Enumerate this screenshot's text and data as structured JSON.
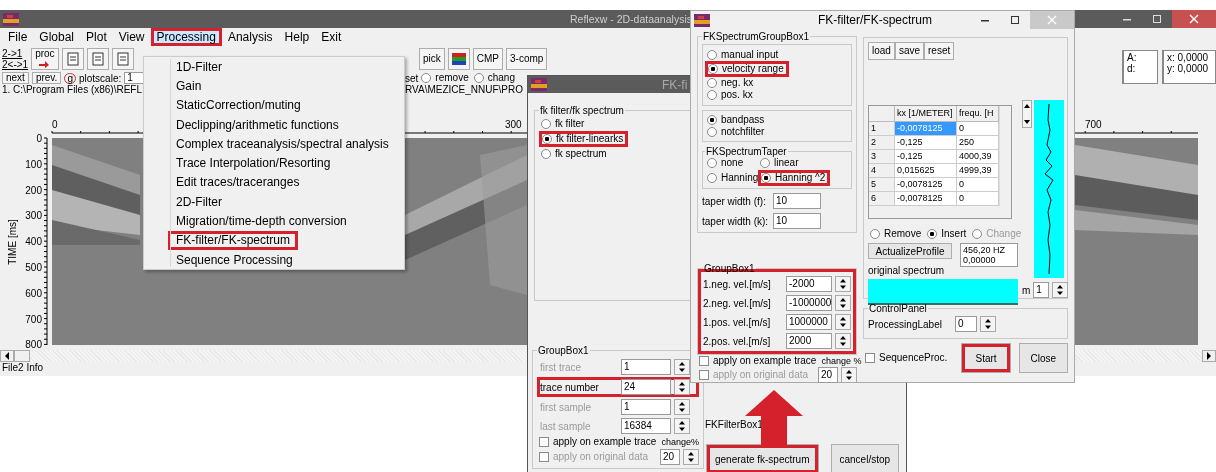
{
  "main_window": {
    "title": "Reflexw - 2D-dataanalysis",
    "menu": [
      {
        "label": "File",
        "selected": false,
        "highlighted": false
      },
      {
        "label": "Global",
        "selected": false,
        "highlighted": false
      },
      {
        "label": "Plot",
        "selected": false,
        "highlighted": false
      },
      {
        "label": "View",
        "selected": false,
        "highlighted": false
      },
      {
        "label": "Processing",
        "selected": true,
        "highlighted": true
      },
      {
        "label": "Analysis",
        "selected": false,
        "highlighted": false
      },
      {
        "label": "Help",
        "selected": false,
        "highlighted": false
      },
      {
        "label": "Exit",
        "selected": false,
        "highlighted": false
      }
    ],
    "menu_items": [
      {
        "label": "1D-Filter",
        "highlighted": false
      },
      {
        "label": "Gain",
        "highlighted": false
      },
      {
        "label": "StaticCorrection/muting",
        "highlighted": false
      },
      {
        "label": "Declipping/arithmetic functions",
        "highlighted": false
      },
      {
        "label": "Complex traceanalysis/spectral analysis",
        "highlighted": false
      },
      {
        "label": "Trace Interpolation/Resorting",
        "highlighted": false
      },
      {
        "label": "Edit traces/traceranges",
        "highlighted": false
      },
      {
        "label": "2D-Filter",
        "highlighted": false
      },
      {
        "label": "Migration/time-depth conversion",
        "highlighted": false
      },
      {
        "label": "FK-filter/FK-spectrum",
        "highlighted": true
      },
      {
        "label": "Sequence Processing",
        "highlighted": false
      }
    ],
    "toolbar": {
      "swap": [
        "2->1",
        "2<->1"
      ],
      "proc": "proc",
      "pick": "pick",
      "cmp": "CMP",
      "comp": "3-comp"
    },
    "nav": {
      "next": "next",
      "prev": "prev.",
      "g": "g",
      "plotscale_label": "plotscale:",
      "plotscale": "1",
      "set": "set",
      "options": [
        {
          "label": "remove",
          "selected": false
        },
        {
          "label": "chang",
          "selected": false
        }
      ]
    },
    "path": [
      "1. C:\\Program Files (x86)\\REFL",
      "RVA\\MEZICE_NNUF\\PRO"
    ],
    "x_ticks": [
      "0",
      "300",
      "700"
    ],
    "y_ticks": [
      "0",
      "100",
      "200",
      "300",
      "400",
      "500",
      "600",
      "700",
      "800"
    ],
    "y_label": "TIME [ms]",
    "info": {
      "a": "A:",
      "d": "d:",
      "x": "x: 0,0000",
      "y": "y: 0,0000"
    },
    "status": "File2 Info"
  },
  "dialog1": {
    "title": "FK-fi",
    "mode_group": "fk filter/fk spectrum",
    "modes": [
      {
        "label": "fk filter",
        "selected": false,
        "highlighted": false
      },
      {
        "label": "fk filter-linearks",
        "selected": true,
        "highlighted": true
      },
      {
        "label": "fk spectrum",
        "selected": false,
        "highlighted": false
      }
    ],
    "range_group": "GroupBox1",
    "ranges": [
      {
        "label": "first trace",
        "value": "1",
        "disabled": true,
        "highlighted": false
      },
      {
        "label": "trace number",
        "value": "24",
        "disabled": false,
        "highlighted": true
      },
      {
        "label": "first sample",
        "value": "1",
        "disabled": true,
        "highlighted": false
      },
      {
        "label": "last sample",
        "value": "16384",
        "disabled": true,
        "highlighted": false
      }
    ],
    "options": [
      {
        "label": "apply on example trace",
        "checked": false,
        "disabled": false
      },
      {
        "label": "apply on original data",
        "checked": false,
        "disabled": true
      }
    ],
    "change_label": "change%",
    "change": "20",
    "filter_group": "FKFilterBox1",
    "buttons": [
      {
        "label": "generate fk-spectrum",
        "highlighted": true
      },
      {
        "label": "cancel/stop",
        "highlighted": false
      }
    ]
  },
  "dialog2": {
    "title": "FK-filter/FK-spectrum",
    "spectrum_group": "FKSpectrumGroupBox1",
    "input_modes": [
      {
        "label": "manual input",
        "selected": false,
        "highlighted": false
      },
      {
        "label": "velocity range",
        "selected": true,
        "highlighted": true
      },
      {
        "label": "neg. kx",
        "selected": false,
        "highlighted": false
      },
      {
        "label": "pos. kx",
        "selected": false,
        "highlighted": false
      }
    ],
    "filter_types": [
      {
        "label": "bandpass",
        "selected": true
      },
      {
        "label": "notchfilter",
        "selected": false
      }
    ],
    "taper_group": "FKSpectrumTaper",
    "tapers": [
      {
        "label": "none",
        "selected": false,
        "highlighted": false
      },
      {
        "label": "Hanning",
        "selected": false,
        "highlighted": false
      },
      {
        "label": "linear",
        "selected": false,
        "highlighted": false
      },
      {
        "label": "Hanning ^2",
        "selected": true,
        "highlighted": true
      }
    ],
    "taper_widths": [
      {
        "label": "taper width (f):",
        "value": "10"
      },
      {
        "label": "taper width (k):",
        "value": "10"
      }
    ],
    "velocity_group": {
      "title": "GroupBox1",
      "highlighted": true
    },
    "velocities": [
      {
        "label": "1.neg. vel.[m/s]",
        "value": "-2000"
      },
      {
        "label": "2.neg. vel.[m/s]",
        "value": "-1000000"
      },
      {
        "label": "1.pos. vel.[m/s]",
        "value": "1000000"
      },
      {
        "label": "2.pos. vel.[m/s]",
        "value": "2000"
      }
    ],
    "options": [
      {
        "label": "apply on example trace",
        "checked": false,
        "disabled": false
      },
      {
        "label": "apply on original data",
        "checked": false,
        "disabled": true
      }
    ],
    "change_label": "change %",
    "change": "20",
    "file_buttons": [
      "load",
      "save",
      "reset"
    ],
    "table": {
      "columns": [
        "",
        "kx [1/METER]",
        "frequ. [H"
      ],
      "rows": [
        {
          "cells": [
            "1",
            "-0,0078125",
            "0"
          ],
          "selected": true
        },
        {
          "cells": [
            "2",
            "-0,125",
            "250"
          ],
          "selected": false
        },
        {
          "cells": [
            "3",
            "-0,125",
            "4000,39"
          ],
          "selected": false
        },
        {
          "cells": [
            "4",
            "0,015625",
            "4999,39"
          ],
          "selected": false
        },
        {
          "cells": [
            "5",
            "-0,0078125",
            "0"
          ],
          "selected": false
        },
        {
          "cells": [
            "6",
            "-0,0078125",
            "0"
          ],
          "selected": false
        }
      ]
    },
    "edit_modes": [
      {
        "label": "Remove",
        "selected": false,
        "disabled": false
      },
      {
        "label": "Insert",
        "selected": true,
        "disabled": false
      },
      {
        "label": "Change",
        "selected": false,
        "disabled": true
      }
    ],
    "actualize": "ActualizeProfile",
    "readout": [
      "456,20 HZ",
      "0,00000"
    ],
    "spectrum_label": "original spectrum",
    "m_label": "m",
    "m": "1",
    "control_group": "ControlPanel",
    "processing_label": "ProcessingLabel",
    "processing": "0",
    "sequence": {
      "label": "SequenceProc.",
      "checked": false
    },
    "start": {
      "label": "Start",
      "highlighted": true
    },
    "close": "Close"
  },
  "annotations": [
    {
      "kind": "arrow"
    }
  ]
}
